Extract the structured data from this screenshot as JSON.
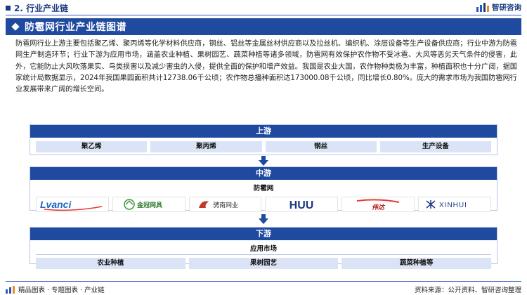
{
  "header": {
    "section_title": "2. 行业产业链",
    "brand_name": "智研咨询"
  },
  "banner": {
    "title": "防雹网行业产业链图谱"
  },
  "description": "防雹网行业上游主要包括聚乙烯、聚丙烯等化学材料供应商，钢丝、铝丝等金属丝材供应商以及拉丝机、编织机、涂层设备等生产设备供应商；行业中游为防雹网生产制造环节；行业下游为应用市场，涵盖农业种植、果树园艺、蔬菜种植等诸多领域，防雹网有效保护农作物不受冰雹、大风等恶劣天气条件的侵害，此外，它能防止大风吹落果实、鸟类损害以及减少害虫的入侵，提供全面的保护和增产效益。我国是农业大国，农作物种类极为丰富，种植面积也十分广阔，据国家统计局数据显示，2024年我国果园面积共计12738.06千公顷；农作物总播种面积达173000.08千公顷，同比增长0.80%。庞大的需求市场为我国防雹网行业发展带来广阔的增长空间。",
  "upstream": {
    "title": "上游",
    "items": [
      "聚乙烯",
      "聚丙烯",
      "钢丝",
      "生产设备"
    ]
  },
  "midstream": {
    "title": "中游",
    "subtitle": "防雹网",
    "logos": [
      "Lvanci",
      "金冠网具",
      "骋南网业",
      "HUU",
      "伟达",
      "XINHUI"
    ]
  },
  "downstream": {
    "title": "下游",
    "subtitle": "应用市场",
    "items": [
      "农业种植",
      "果树园艺",
      "蔬菜种植等"
    ]
  },
  "footer": {
    "left": "精品图表 · 专题图表 · 产业链",
    "right": "资料来源：公开资料、智研咨询整理"
  },
  "colors": {
    "primary": "#1f4aa0",
    "cell_bg": "#dbe4f6",
    "border": "#b9c6e6"
  }
}
